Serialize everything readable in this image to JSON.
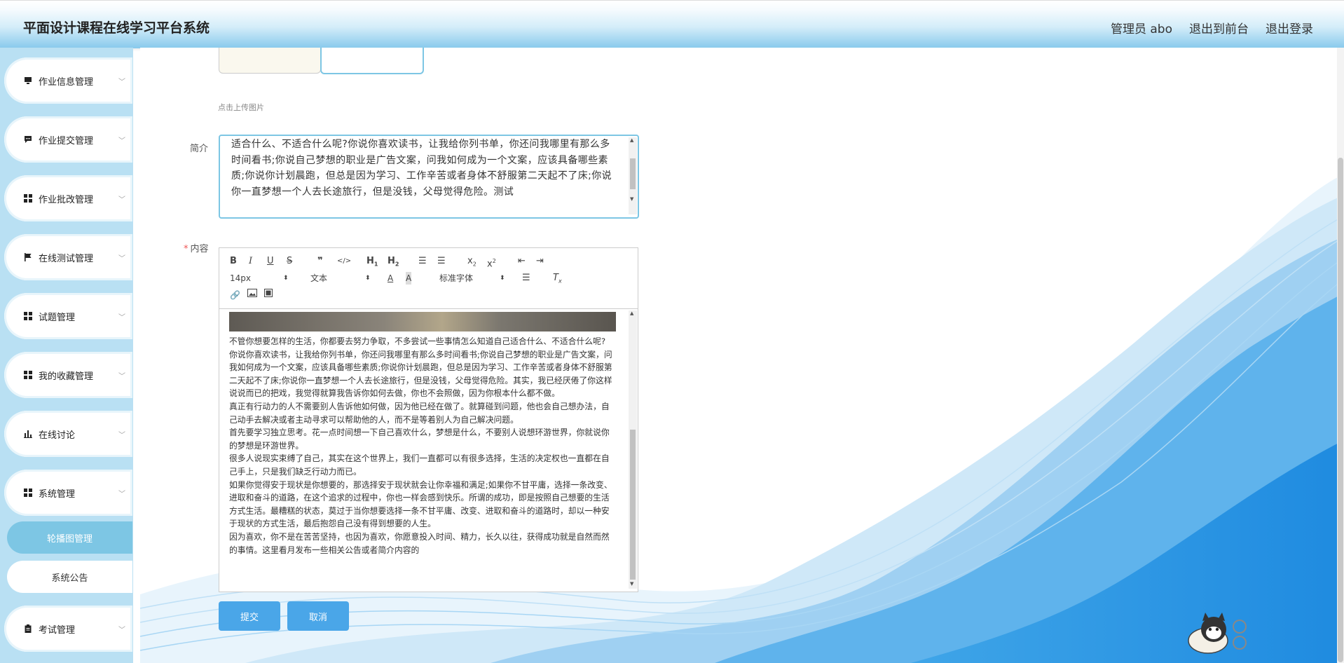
{
  "header": {
    "title": "平面设计课程在线学习平台系统",
    "actions": [
      "管理员 abo",
      "退出到前台",
      "退出登录"
    ]
  },
  "sidebar": {
    "items": [
      {
        "label": "作业信息管理",
        "icon": "monitor-icon"
      },
      {
        "label": "作业提交管理",
        "icon": "chat-icon"
      },
      {
        "label": "作业批改管理",
        "icon": "grid-icon"
      },
      {
        "label": "在线测试管理",
        "icon": "flag-icon"
      },
      {
        "label": "试题管理",
        "icon": "grid-icon"
      },
      {
        "label": "我的收藏管理",
        "icon": "grid-icon"
      },
      {
        "label": "在线讨论",
        "icon": "bar-chart-icon"
      },
      {
        "label": "系统管理",
        "icon": "grid-icon"
      }
    ],
    "sub_items": [
      {
        "label": "轮播图管理",
        "active": true
      },
      {
        "label": "系统公告",
        "active": false
      }
    ],
    "last_item": {
      "label": "考试管理",
      "icon": "clipboard-icon"
    }
  },
  "form": {
    "upload_tip": "点击上传图片",
    "intro_label": "简介",
    "intro_value": "适合什么、不适合什么呢?你说你喜欢读书，让我给你列书单，你还问我哪里有那么多时间看书;你说自己梦想的职业是广告文案，问我如何成为一个文案，应该具备哪些素质;你说你计划晨跑，但总是因为学习、工作辛苦或者身体不舒服第二天起不了床;你说你一直梦想一个人去长途旅行，但是没钱，父母觉得危险。测试",
    "content_label": "内容",
    "toolbar": {
      "size_select": "14px",
      "header_select": "文本",
      "font_select": "标准字体"
    },
    "content_paragraphs": [
      "不管你想要怎样的生活，你都要去努力争取，不多尝试一些事情怎么知道自己适合什么、不适合什么呢?",
      "你说你喜欢读书，让我给你列书单，你还问我哪里有那么多时间看书;你说自己梦想的职业是广告文案，问我如何成为一个文案，应该具备哪些素质;你说你计划晨跑，但总是因为学习、工作辛苦或者身体不舒服第二天起不了床;你说你一直梦想一个人去长途旅行，但是没钱，父母觉得危险。其实，我已经厌倦了你这样说说而已的把戏，我觉得就算我告诉你如何去做，你也不会照做，因为你根本什么都不做。",
      "真正有行动力的人不需要别人告诉他如何做，因为他已经在做了。就算碰到问题，他也会自己想办法，自己动手去解决或者主动寻求可以帮助他的人，而不是等着别人为自己解决问题。",
      "首先要学习独立思考。花一点时间想一下自己喜欢什么，梦想是什么，不要别人说想环游世界，你就说你的梦想是环游世界。",
      "很多人说现实束缚了自己，其实在这个世界上，我们一直都可以有很多选择，生活的决定权也一直都在自己手上，只是我们缺乏行动力而已。",
      "如果你觉得安于现状是你想要的，那选择安于现状就会让你幸福和满足;如果你不甘平庸，选择一条改变、进取和奋斗的道路，在这个追求的过程中，你也一样会感到快乐。所谓的成功，即是按照自己想要的生活方式生活。最糟糕的状态，莫过于当你想要选择一条不甘平庸、改变、进取和奋斗的道路时，却以一种安于现状的方式生活，最后抱怨自己没有得到想要的人生。",
      "因为喜欢，你不是在苦苦坚持，也因为喜欢，你愿意投入时间、精力，长久以往，获得成功就是自然而然的事情。这里看月发布一些相关公告或者简介内容的"
    ],
    "submit_label": "提交",
    "cancel_label": "取消"
  },
  "colors": {
    "accent": "#7dc6e4",
    "button": "#4aa6e8",
    "sidebar_bg": "#b9e0f3"
  }
}
